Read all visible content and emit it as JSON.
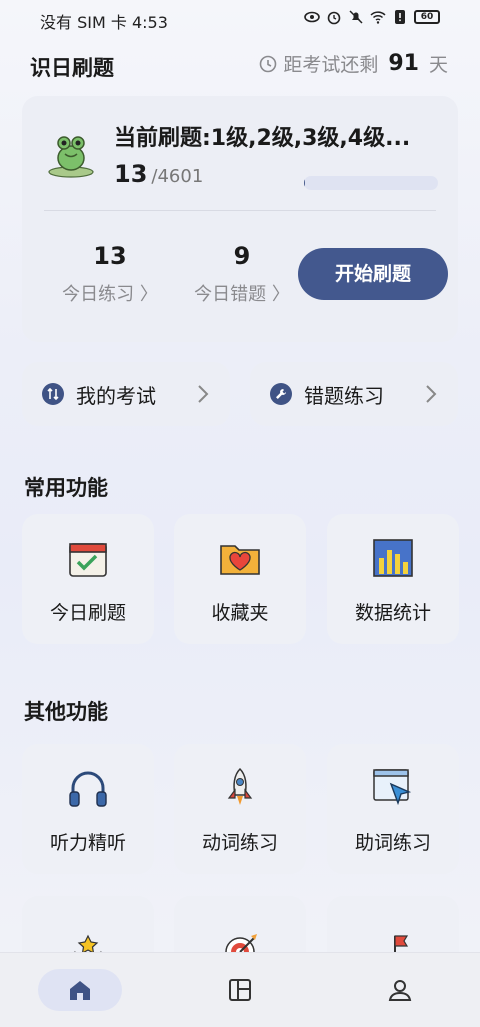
{
  "status": {
    "carrier_time": "没有 SIM 卡 4:53",
    "battery": "60"
  },
  "header": {
    "title": "识日刷题",
    "countdown_prefix": "距考试还剩",
    "countdown_days": "91",
    "countdown_unit": "天"
  },
  "current": {
    "title": "当前刷题:1级,2级,3级,4级...",
    "done": "13",
    "total": "/4601",
    "progress_fraction": 0.003,
    "today_practice_value": "13",
    "today_practice_label": "今日练习 〉",
    "today_wrong_value": "9",
    "today_wrong_label": "今日错题 〉",
    "start_button": "开始刷题"
  },
  "quick": {
    "exam_label": "我的考试",
    "mistakes_label": "错题练习"
  },
  "sections": {
    "common_title": "常用功能",
    "common": [
      {
        "label": "今日刷题",
        "icon": "calendar-check-icon"
      },
      {
        "label": "收藏夹",
        "icon": "heart-folder-icon"
      },
      {
        "label": "数据统计",
        "icon": "bar-chart-icon"
      }
    ],
    "other_title": "其他功能",
    "other": [
      {
        "label": "听力精听",
        "icon": "headphones-icon"
      },
      {
        "label": "动词练习",
        "icon": "rocket-icon"
      },
      {
        "label": "助词练习",
        "icon": "cursor-click-icon"
      }
    ]
  },
  "colors": {
    "accent": "#43588e",
    "progress": "#4a5e8e"
  }
}
